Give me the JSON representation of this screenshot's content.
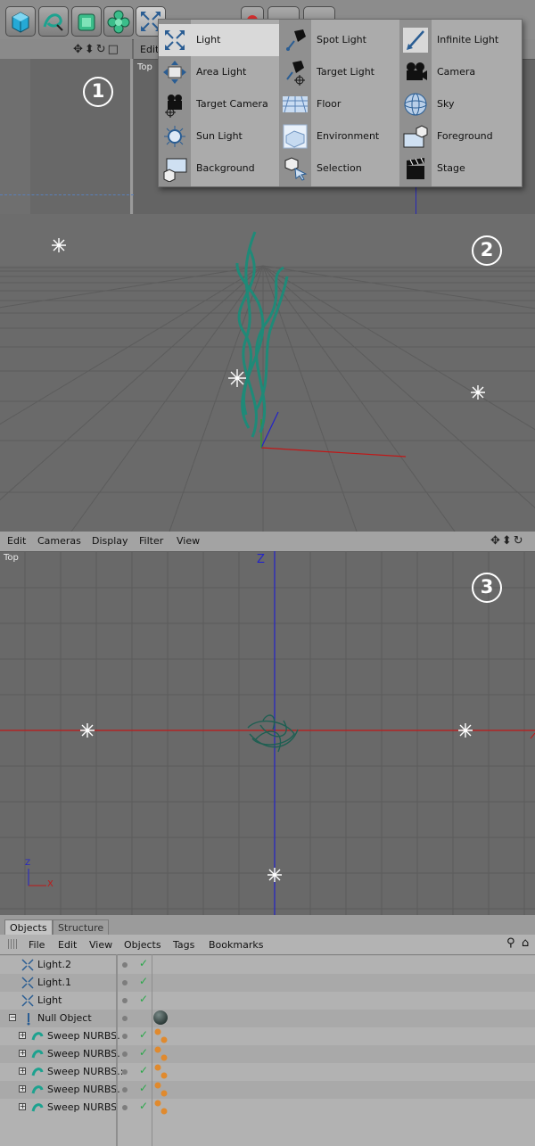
{
  "badges": [
    "1",
    "2",
    "3"
  ],
  "panel1": {
    "menu_fragment": "Edit",
    "view_label": "Top"
  },
  "light_menu": {
    "columns": [
      [
        {
          "label": "Light",
          "icon": "light-icon",
          "selected": true
        },
        {
          "label": "Area Light",
          "icon": "area-light-icon"
        },
        {
          "label": "Target Camera",
          "icon": "target-camera-icon"
        },
        {
          "label": "Sun Light",
          "icon": "sun-light-icon"
        },
        {
          "label": "Background",
          "icon": "background-icon"
        }
      ],
      [
        {
          "label": "Spot Light",
          "icon": "spot-light-icon"
        },
        {
          "label": "Target Light",
          "icon": "target-light-icon"
        },
        {
          "label": "Floor",
          "icon": "floor-icon"
        },
        {
          "label": "Environment",
          "icon": "environment-icon"
        },
        {
          "label": "Selection",
          "icon": "selection-icon"
        }
      ],
      [
        {
          "label": "Infinite Light",
          "icon": "infinite-light-icon"
        },
        {
          "label": "Camera",
          "icon": "camera-icon"
        },
        {
          "label": "Sky",
          "icon": "sky-icon"
        },
        {
          "label": "Foreground",
          "icon": "foreground-icon"
        },
        {
          "label": "Stage",
          "icon": "stage-icon"
        }
      ]
    ]
  },
  "panel3": {
    "menu": [
      "Edit",
      "Cameras",
      "Display",
      "Filter",
      "View"
    ],
    "view_label": "Top",
    "axis_z": "Z",
    "gizmo_z": "Z",
    "gizmo_x": "X"
  },
  "objects_panel": {
    "tabs": [
      "Objects",
      "Structure"
    ],
    "menu": [
      "File",
      "Edit",
      "View",
      "Objects",
      "Tags",
      "Bookmarks"
    ],
    "rows": [
      {
        "name": "Light.2",
        "type": "light"
      },
      {
        "name": "Light.1",
        "type": "light"
      },
      {
        "name": "Light",
        "type": "light"
      },
      {
        "name": "Null Object",
        "type": "null"
      },
      {
        "name": "Sweep NURBS.",
        "type": "sweep"
      },
      {
        "name": "Sweep NURBS.",
        "type": "sweep"
      },
      {
        "name": "Sweep NURBS.:",
        "type": "sweep"
      },
      {
        "name": "Sweep NURBS.",
        "type": "sweep"
      },
      {
        "name": "Sweep NURBS",
        "type": "sweep"
      }
    ]
  },
  "colors": {
    "strand": "#1f8a78",
    "axis_x": "#c01818",
    "axis_z": "#2323c8",
    "check": "#2aa84a"
  }
}
